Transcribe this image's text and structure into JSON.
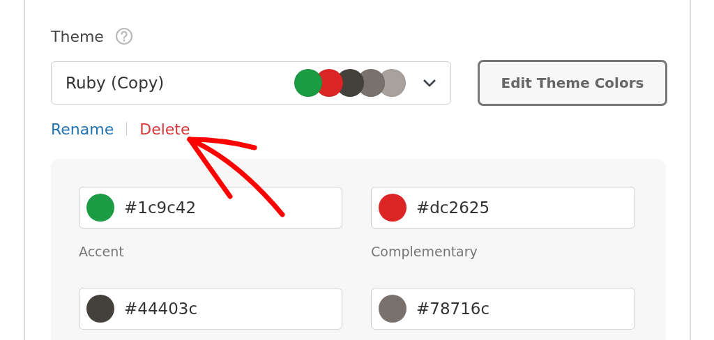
{
  "theme": {
    "label": "Theme",
    "select": {
      "value": "Ruby (Copy)",
      "swatches": [
        {
          "color": "#1c9c42"
        },
        {
          "color": "#dc2625"
        },
        {
          "color": "#44403c"
        },
        {
          "color": "#78716c"
        },
        {
          "color": "#a8a29e"
        }
      ]
    },
    "edit_button": "Edit Theme Colors",
    "actions": [
      {
        "kind": "rename",
        "label": "Rename"
      },
      {
        "kind": "delete",
        "label": "Delete"
      }
    ]
  },
  "colors": [
    {
      "value": "#1c9c42",
      "color": "#1c9c42",
      "label": "Accent"
    },
    {
      "value": "#dc2625",
      "color": "#dc2625",
      "label": "Complementary"
    },
    {
      "value": "#44403c",
      "color": "#44403c"
    },
    {
      "value": "#78716c",
      "color": "#78716c"
    }
  ]
}
